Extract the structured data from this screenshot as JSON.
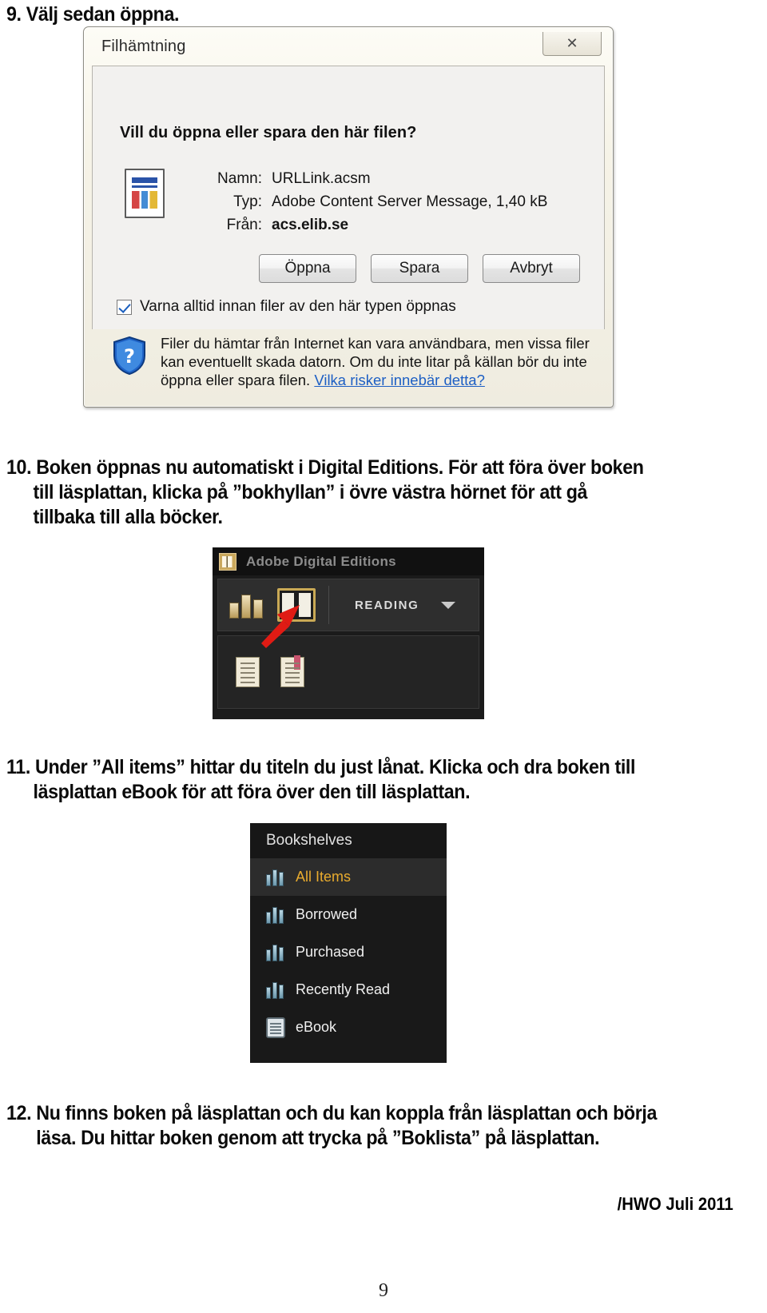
{
  "document": {
    "page_number": "9",
    "footer_signature": "/HWO Juli 2011"
  },
  "steps": {
    "step9": {
      "number": "9.",
      "text": "Välj sedan öppna."
    },
    "step10": {
      "number": "10.",
      "line1": "Boken öppnas nu automatiskt i Digital Editions. För att föra över boken",
      "line2": "till läsplattan, klicka på ”bokhyllan” i övre västra hörnet för att gå",
      "line3": "tillbaka till alla böcker."
    },
    "step11": {
      "number": "11.",
      "line1": "Under ”All items” hittar du titeln du just lånat. Klicka och dra boken till",
      "line2": "läsplattan eBook för att föra över den till läsplattan."
    },
    "step12": {
      "number": "12.",
      "line1": "Nu finns boken på läsplattan och du kan koppla från läsplattan och börja",
      "line2": "läsa. Du hittar boken genom att trycka på ”Boklista” på läsplattan."
    }
  },
  "file_download_dialog": {
    "title": "Filhämtning",
    "close_label": "✕",
    "question": "Vill du öppna eller spara den här filen?",
    "fields": [
      {
        "label": "Namn:",
        "value": "URLLink.acsm",
        "bold": false
      },
      {
        "label": "Typ:",
        "value": "Adobe Content Server Message, 1,40 kB",
        "bold": false
      },
      {
        "label": "Från:",
        "value": "acs.elib.se",
        "bold": true
      }
    ],
    "buttons": {
      "open": "Öppna",
      "save": "Spara",
      "cancel": "Avbryt"
    },
    "checkbox": {
      "label": "Varna alltid innan filer av den här typen öppnas",
      "checked": true
    },
    "warning": {
      "line1": "Filer du hämtar från Internet kan vara användbara, men vissa filer",
      "line2": "kan eventuellt skada datorn. Om du inte litar på källan bör du inte",
      "line3": "öppna eller spara filen.",
      "link": "Vilka risker innebär detta?"
    },
    "colors": {
      "link": "#1d5fc4",
      "titlebar": "#f6f3e7"
    }
  },
  "adobe_digital_editions": {
    "app_title": "Adobe Digital Editions",
    "mode_label": "READING",
    "toolbar_icons": [
      "bookshelf-icon",
      "reading-view-icon"
    ],
    "lower_icons": [
      "library-list-icon",
      "bookmark-doc-icon"
    ],
    "annotation": {
      "type": "red-arrow",
      "points_to": "bookshelf-icon",
      "color": "#e01b14"
    }
  },
  "bookshelves_panel": {
    "header": "Bookshelves",
    "items": [
      {
        "label": "All Items",
        "icon": "bookshelf-icon",
        "selected": true
      },
      {
        "label": "Borrowed",
        "icon": "bookshelf-icon",
        "selected": false
      },
      {
        "label": "Purchased",
        "icon": "bookshelf-icon",
        "selected": false
      },
      {
        "label": "Recently Read",
        "icon": "bookshelf-icon",
        "selected": false
      },
      {
        "label": "eBook",
        "icon": "device-icon",
        "selected": false
      }
    ],
    "colors": {
      "selected_text": "#e8ab2e",
      "background": "#191919"
    }
  }
}
